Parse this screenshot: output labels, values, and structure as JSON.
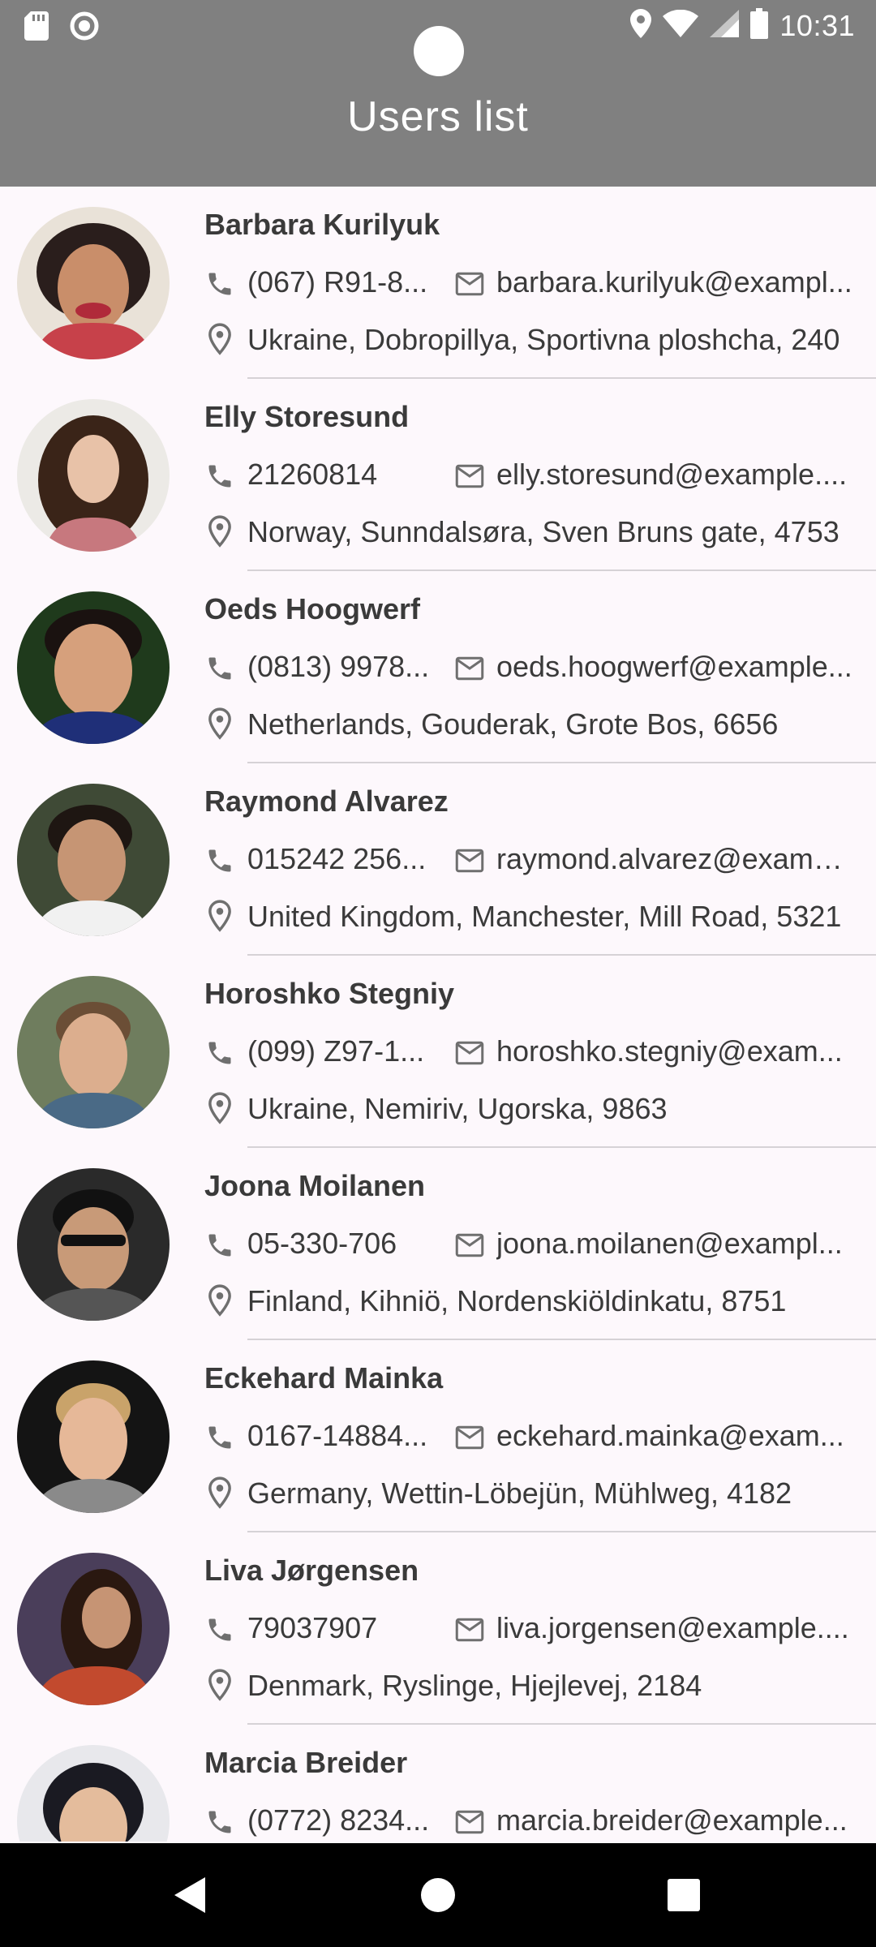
{
  "status_bar": {
    "time": "10:31",
    "left_icons": [
      "sd-card-icon",
      "circle-icon"
    ],
    "right_icons": [
      "location-icon",
      "wifi-icon",
      "signal-icon",
      "battery-icon"
    ]
  },
  "app_bar": {
    "title": "Users list",
    "background": "#808080"
  },
  "users": [
    {
      "name": "Barbara Kurilyuk",
      "phone": "(067) R91-8...",
      "email": "barbara.kurilyuk@exampl...",
      "address": "Ukraine, Dobropillya, Sportivna ploshcha, 240"
    },
    {
      "name": "Elly Storesund",
      "phone": "21260814",
      "email": "elly.storesund@example....",
      "address": "Norway, Sunndalsøra, Sven Bruns gate, 4753"
    },
    {
      "name": "Oeds Hoogwerf",
      "phone": "(0813) 9978...",
      "email": "oeds.hoogwerf@example...",
      "address": "Netherlands, Gouderak, Grote Bos, 6656"
    },
    {
      "name": "Raymond Alvarez",
      "phone": "015242 256...",
      "email": "raymond.alvarez@examp...",
      "address": "United Kingdom, Manchester, Mill Road, 5321"
    },
    {
      "name": "Horoshko Stegniy",
      "phone": "(099) Z97-1...",
      "email": "horoshko.stegniy@exam...",
      "address": "Ukraine, Nemiriv, Ugorska, 9863"
    },
    {
      "name": "Joona Moilanen",
      "phone": "05-330-706",
      "email": "joona.moilanen@exampl...",
      "address": "Finland, Kihniö, Nordenskiöldinkatu, 8751"
    },
    {
      "name": "Eckehard Mainka",
      "phone": "0167-14884...",
      "email": "eckehard.mainka@exam...",
      "address": "Germany, Wettin-Löbejün, Mühlweg, 4182"
    },
    {
      "name": "Liva Jørgensen",
      "phone": "79037907",
      "email": "liva.jorgensen@example....",
      "address": "Denmark, Ryslinge, Hjejlevej, 2184"
    },
    {
      "name": "Marcia Breider",
      "phone": "(0772) 8234...",
      "email": "marcia.breider@example...",
      "address": ""
    }
  ],
  "nav_bar": {
    "buttons": [
      "back-icon",
      "home-icon",
      "recents-icon"
    ]
  }
}
